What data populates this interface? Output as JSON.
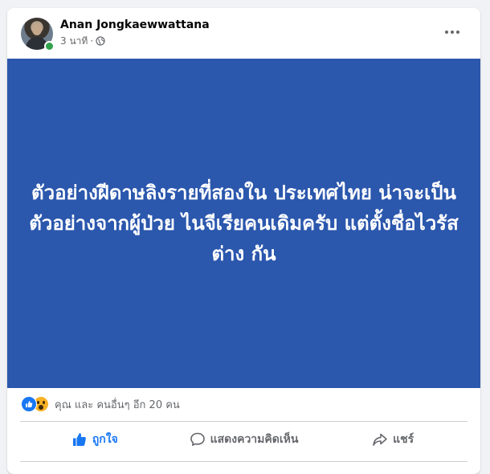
{
  "post": {
    "author": "Anan Jongkaewwattana",
    "time": "3 นาที",
    "separator": "·",
    "privacy_icon": "globe-icon",
    "more_icon": "more-horizontal-icon",
    "image_text": "ตัวอย่างฝีดาษลิงรายที่สองใน ประเทศไทย น่าจะเป็นตัวอย่างจากผู้ป่วย ไนจีเรียคนเดิมครับ แต่ตั้งชื่อไวรัสต่าง กัน",
    "image_background": "#2b57ad"
  },
  "reactions": {
    "icons": [
      "like-icon",
      "wow-icon"
    ],
    "summary": "คุณ และ คนอื่นๆ อีก 20 คน"
  },
  "actions": {
    "like_label": "ถูกใจ",
    "comment_label": "แสดงความคิดเห็น",
    "share_label": "แชร์"
  },
  "colors": {
    "accent": "#1877f2",
    "secondary_text": "#65676b",
    "online": "#31a24c"
  }
}
